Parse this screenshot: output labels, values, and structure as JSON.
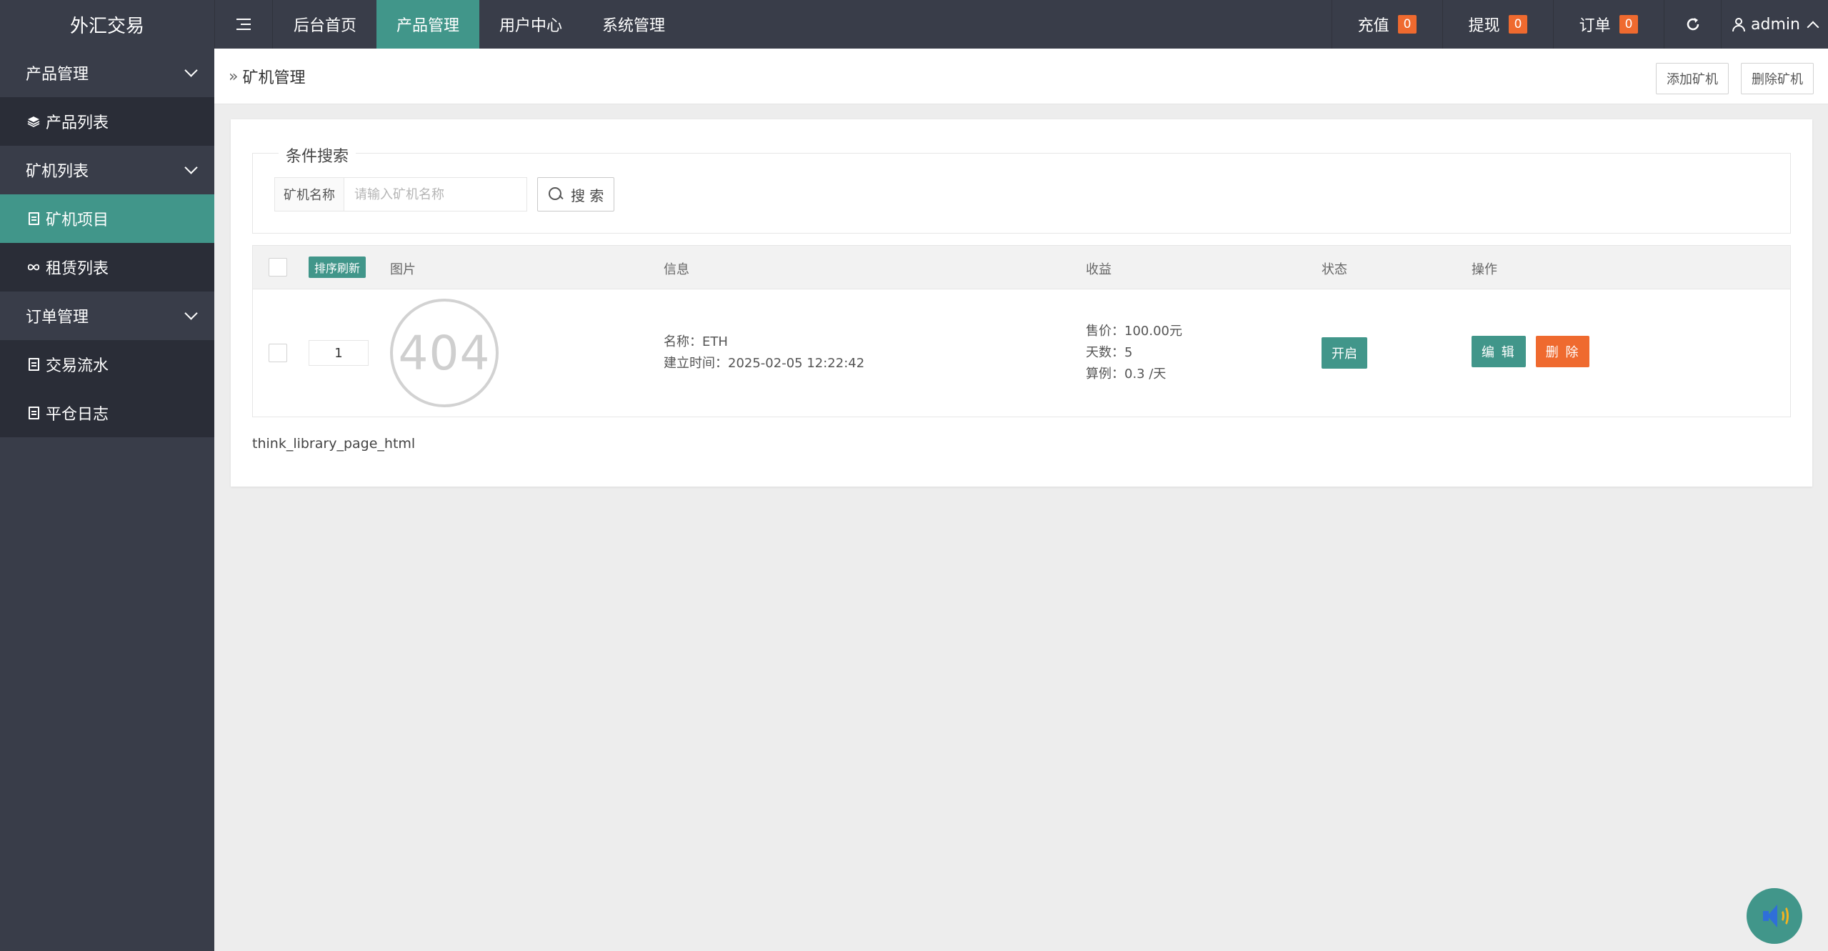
{
  "app": {
    "brand": "外汇交易"
  },
  "topnav": {
    "items": [
      {
        "label": "后台首页"
      },
      {
        "label": "产品管理"
      },
      {
        "label": "用户中心"
      },
      {
        "label": "系统管理"
      }
    ],
    "active_index": 1
  },
  "topright": {
    "recharge": {
      "label": "充值",
      "count": "0"
    },
    "withdraw": {
      "label": "提现",
      "count": "0"
    },
    "orders": {
      "label": "订单",
      "count": "0"
    },
    "refresh_icon": "refresh-icon",
    "user": {
      "name": "admin"
    }
  },
  "sidebar": {
    "groups": [
      {
        "label": "产品管理",
        "items": [
          {
            "label": "产品列表",
            "icon": "layers-icon"
          }
        ]
      },
      {
        "label": "矿机列表",
        "items": [
          {
            "label": "矿机项目",
            "icon": "document-icon",
            "active": true
          },
          {
            "label": "租赁列表",
            "icon": "infinity-icon"
          }
        ]
      },
      {
        "label": "订单管理",
        "items": [
          {
            "label": "交易流水",
            "icon": "document-icon"
          },
          {
            "label": "平仓日志",
            "icon": "document-icon"
          }
        ]
      }
    ]
  },
  "content_header": {
    "breadcrumb": "矿机管理",
    "add_button": "添加矿机",
    "delete_button": "删除矿机"
  },
  "search": {
    "legend": "条件搜索",
    "field_label": "矿机名称",
    "placeholder": "请输入矿机名称",
    "button": "搜 索"
  },
  "table": {
    "sort_button": "排序刷新",
    "headers": {
      "image": "图片",
      "info": "信息",
      "income": "收益",
      "status": "状态",
      "actions": "操作"
    },
    "rows": [
      {
        "sort": "1",
        "image_placeholder": "404",
        "name_line": "名称：ETH",
        "created_line": "建立时间：2025-02-05 12:22:42",
        "price_line": "售价：100.00元",
        "days_line": "天数：5",
        "rate_line": "算例：0.3 /天",
        "status": "开启",
        "edit": "编 辑",
        "delete": "删 除"
      }
    ]
  },
  "pagination_text": "think_library_page_html",
  "colors": {
    "topbar": "#393d49",
    "accent": "#41968a",
    "danger": "#ef6a2f"
  }
}
